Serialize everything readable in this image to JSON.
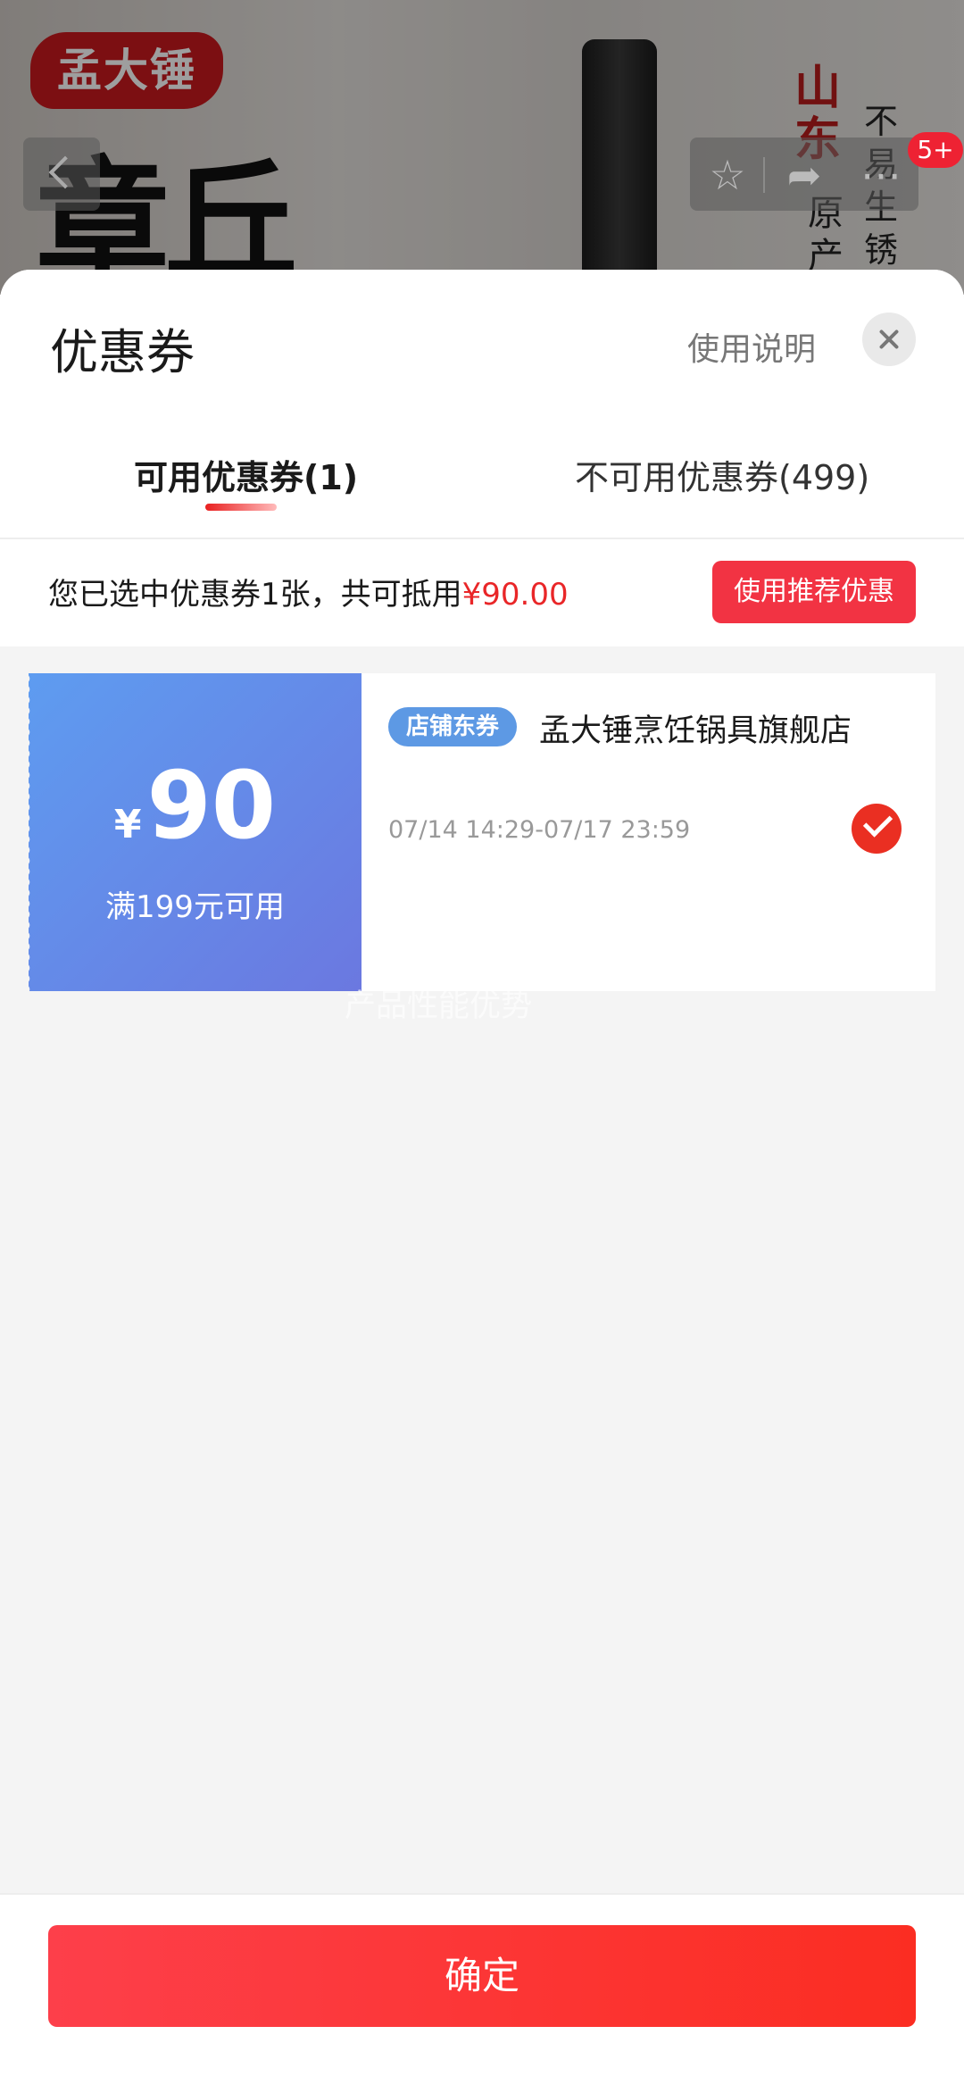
{
  "background": {
    "brand_seal": "孟大锤",
    "brand_calligraphy": "章丘",
    "red_calligraphy": "山东",
    "side_text_col1": "原产",
    "side_text_col2": "不易生锈",
    "nav_badge": "5+",
    "icons": [
      "back-icon",
      "star-icon",
      "share-icon",
      "more-icon"
    ]
  },
  "sheet": {
    "title": "优惠券",
    "help_link": "使用说明",
    "tabs": [
      {
        "label": "可用优惠券(1)",
        "active": true
      },
      {
        "label": "不可用优惠券(499)",
        "active": false
      }
    ],
    "summary": {
      "text": "您已选中优惠券1张，共可抵用",
      "amount": "¥90.00"
    },
    "recommend_button": "使用推荐优惠"
  },
  "coupon": {
    "currency": "¥",
    "value": "90",
    "condition": "满199元可用",
    "tag": "店铺东券",
    "shop": "孟大锤烹饪锅具旗舰店",
    "validity": "07/14 14:29-07/17 23:59",
    "selected": true
  },
  "ghost_text": "产品性能优势",
  "footer": {
    "confirm_label": "确定"
  },
  "colors": {
    "accent_red": "#f23343",
    "coupon_blue": "#5e9cf0",
    "amount_red": "#e92628"
  }
}
